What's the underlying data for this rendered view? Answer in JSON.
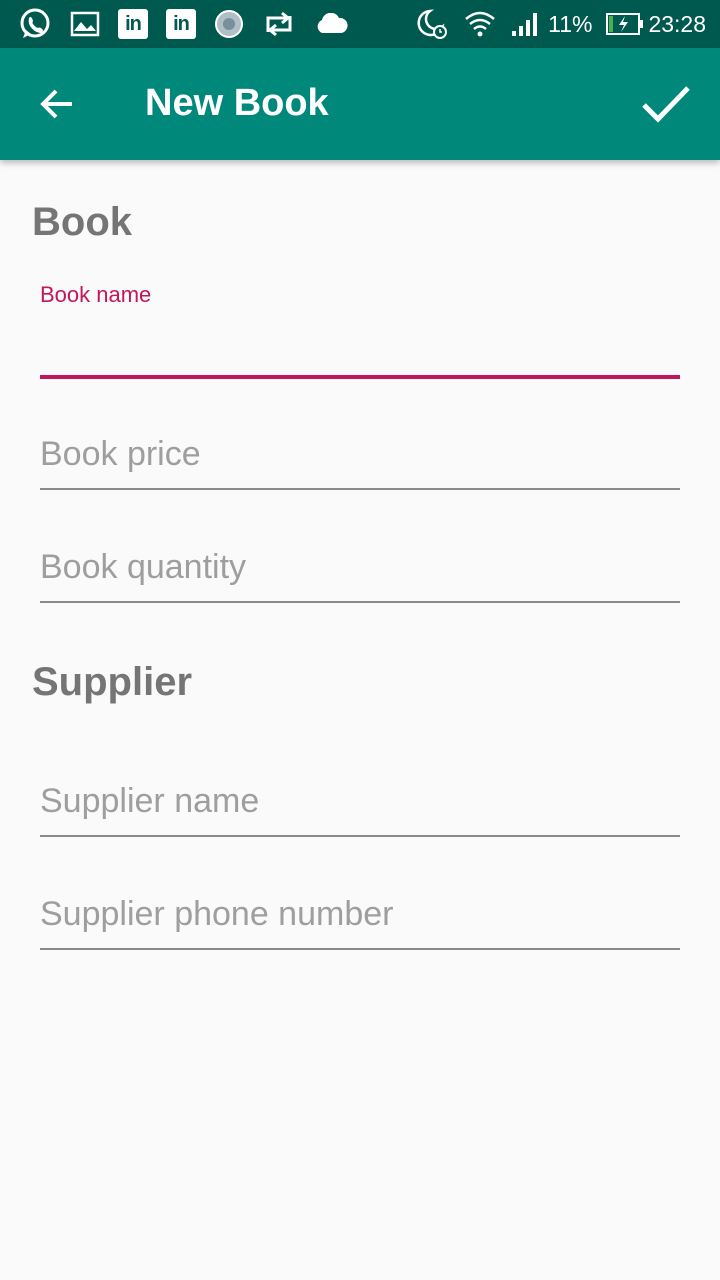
{
  "status_bar": {
    "battery_percent": "11%",
    "time": "23:28",
    "left_icons": [
      "whatsapp-icon",
      "image-icon",
      "linkedin-icon",
      "linkedin-icon",
      "app-icon",
      "retweet-icon",
      "cloud-icon"
    ],
    "right_icons": [
      "night-alarm-icon",
      "wifi-icon",
      "signal-icon",
      "battery-charging-icon"
    ],
    "linkedin_text": "in"
  },
  "app_bar": {
    "title": "New Book",
    "back_icon": "arrow-back-icon",
    "save_icon": "check-icon"
  },
  "sections": {
    "book_title": "Book",
    "supplier_title": "Supplier"
  },
  "fields": {
    "book_name": {
      "label": "Book name",
      "value": ""
    },
    "book_price": {
      "placeholder": "Book price"
    },
    "book_quantity": {
      "placeholder": "Book quantity"
    },
    "supplier_name": {
      "placeholder": "Supplier name"
    },
    "supplier_phone": {
      "placeholder": "Supplier phone number"
    }
  },
  "colors": {
    "status_bar": "#00594f",
    "app_bar": "#00897b",
    "accent": "#c2185b",
    "background": "#fafafa"
  }
}
